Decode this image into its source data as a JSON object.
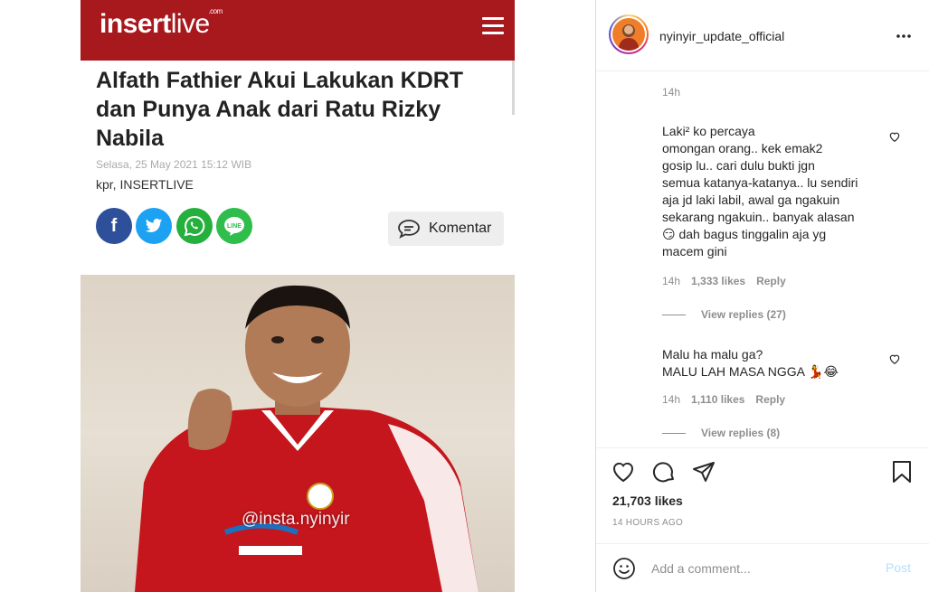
{
  "article": {
    "logo_main": "insert",
    "logo_sub": "live",
    "logo_com": ".com",
    "title": "Alfath Fathier Akui Lakukan KDRT dan Punya Anak dari Ratu Rizky Nabila",
    "date": "Selasa, 25 May 2021 15:12 WIB",
    "author": "kpr, INSERTLIVE",
    "share": {
      "facebook": "f",
      "twitter": "t",
      "whatsapp": "w",
      "line": "LINE"
    },
    "comment_label": "Komentar",
    "photo_watermark": "@insta.nyinyir",
    "colors": {
      "header": "#a8191e",
      "facebook": "#2e4f9a",
      "twitter": "#1da1f2",
      "whatsapp": "#25b03e",
      "line": "#2fbd4c"
    }
  },
  "post": {
    "username": "nyinyir_update_official",
    "top_time": "14h",
    "comments": [
      {
        "text": "Laki² ko percaya\nomongan orang.. kek emak2\ngosip lu.. cari dulu bukti jgn\nsemua katanya-katanya.. lu sendiri\naja jd laki labil, awal ga ngakuin\nsekarang ngakuin.. banyak alasan\n😏 dah bagus tinggalin aja yg\nmacem gini",
        "time": "14h",
        "likes": "1,333 likes",
        "reply": "Reply",
        "view_replies": "View replies (27)"
      },
      {
        "text": "Malu ha malu ga?\nMALU LAH MASA NGGA 💃😂",
        "time": "14h",
        "likes": "1,110 likes",
        "reply": "Reply",
        "view_replies": "View replies (8)"
      }
    ],
    "likes_count": "21,703 likes",
    "post_time": "14 HOURS AGO",
    "add_comment_placeholder": "Add a comment...",
    "post_label": "Post",
    "icons": [
      "heart-icon",
      "comment-icon",
      "share-icon",
      "bookmark-icon",
      "more-icon",
      "emoji-icon"
    ]
  }
}
